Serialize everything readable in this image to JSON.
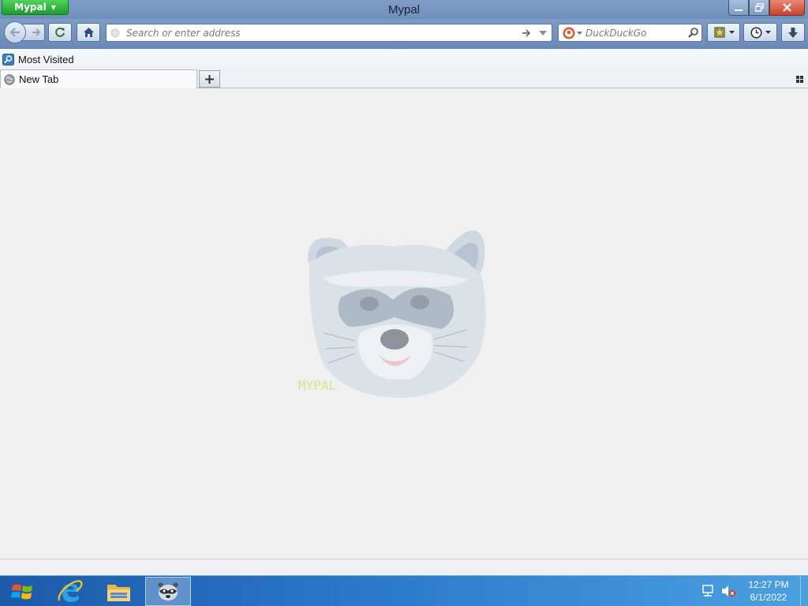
{
  "window": {
    "app_menu_label": "Mypal",
    "title": "Mypal"
  },
  "navbar": {
    "url_placeholder": "Search or enter address",
    "search_engine": "DuckDuckGo",
    "search_placeholder": "DuckDuckGo"
  },
  "bookmarks_toolbar": {
    "items": [
      {
        "label": "Most Visited",
        "icon": "most-visited-icon"
      }
    ]
  },
  "tabs": [
    {
      "label": "New Tab",
      "icon": "globe-icon",
      "active": true
    }
  ],
  "content": {
    "background_image": "raccoon-mascot",
    "watermark_text": "MYPAL"
  },
  "taskbar": {
    "items": [
      {
        "name": "start-button",
        "icon": "windows-logo-icon"
      },
      {
        "name": "internet-explorer",
        "icon": "ie-icon"
      },
      {
        "name": "file-explorer",
        "icon": "folder-icon"
      },
      {
        "name": "mypal",
        "icon": "raccoon-icon",
        "active": true
      }
    ],
    "clock": {
      "time": "12:27 PM",
      "date": "6/1/2022"
    }
  },
  "colors": {
    "app_button": "#2db33a",
    "chrome_blue": "#6a89b6",
    "close_button": "#c8432b",
    "content_bg": "#f0f0f0"
  }
}
